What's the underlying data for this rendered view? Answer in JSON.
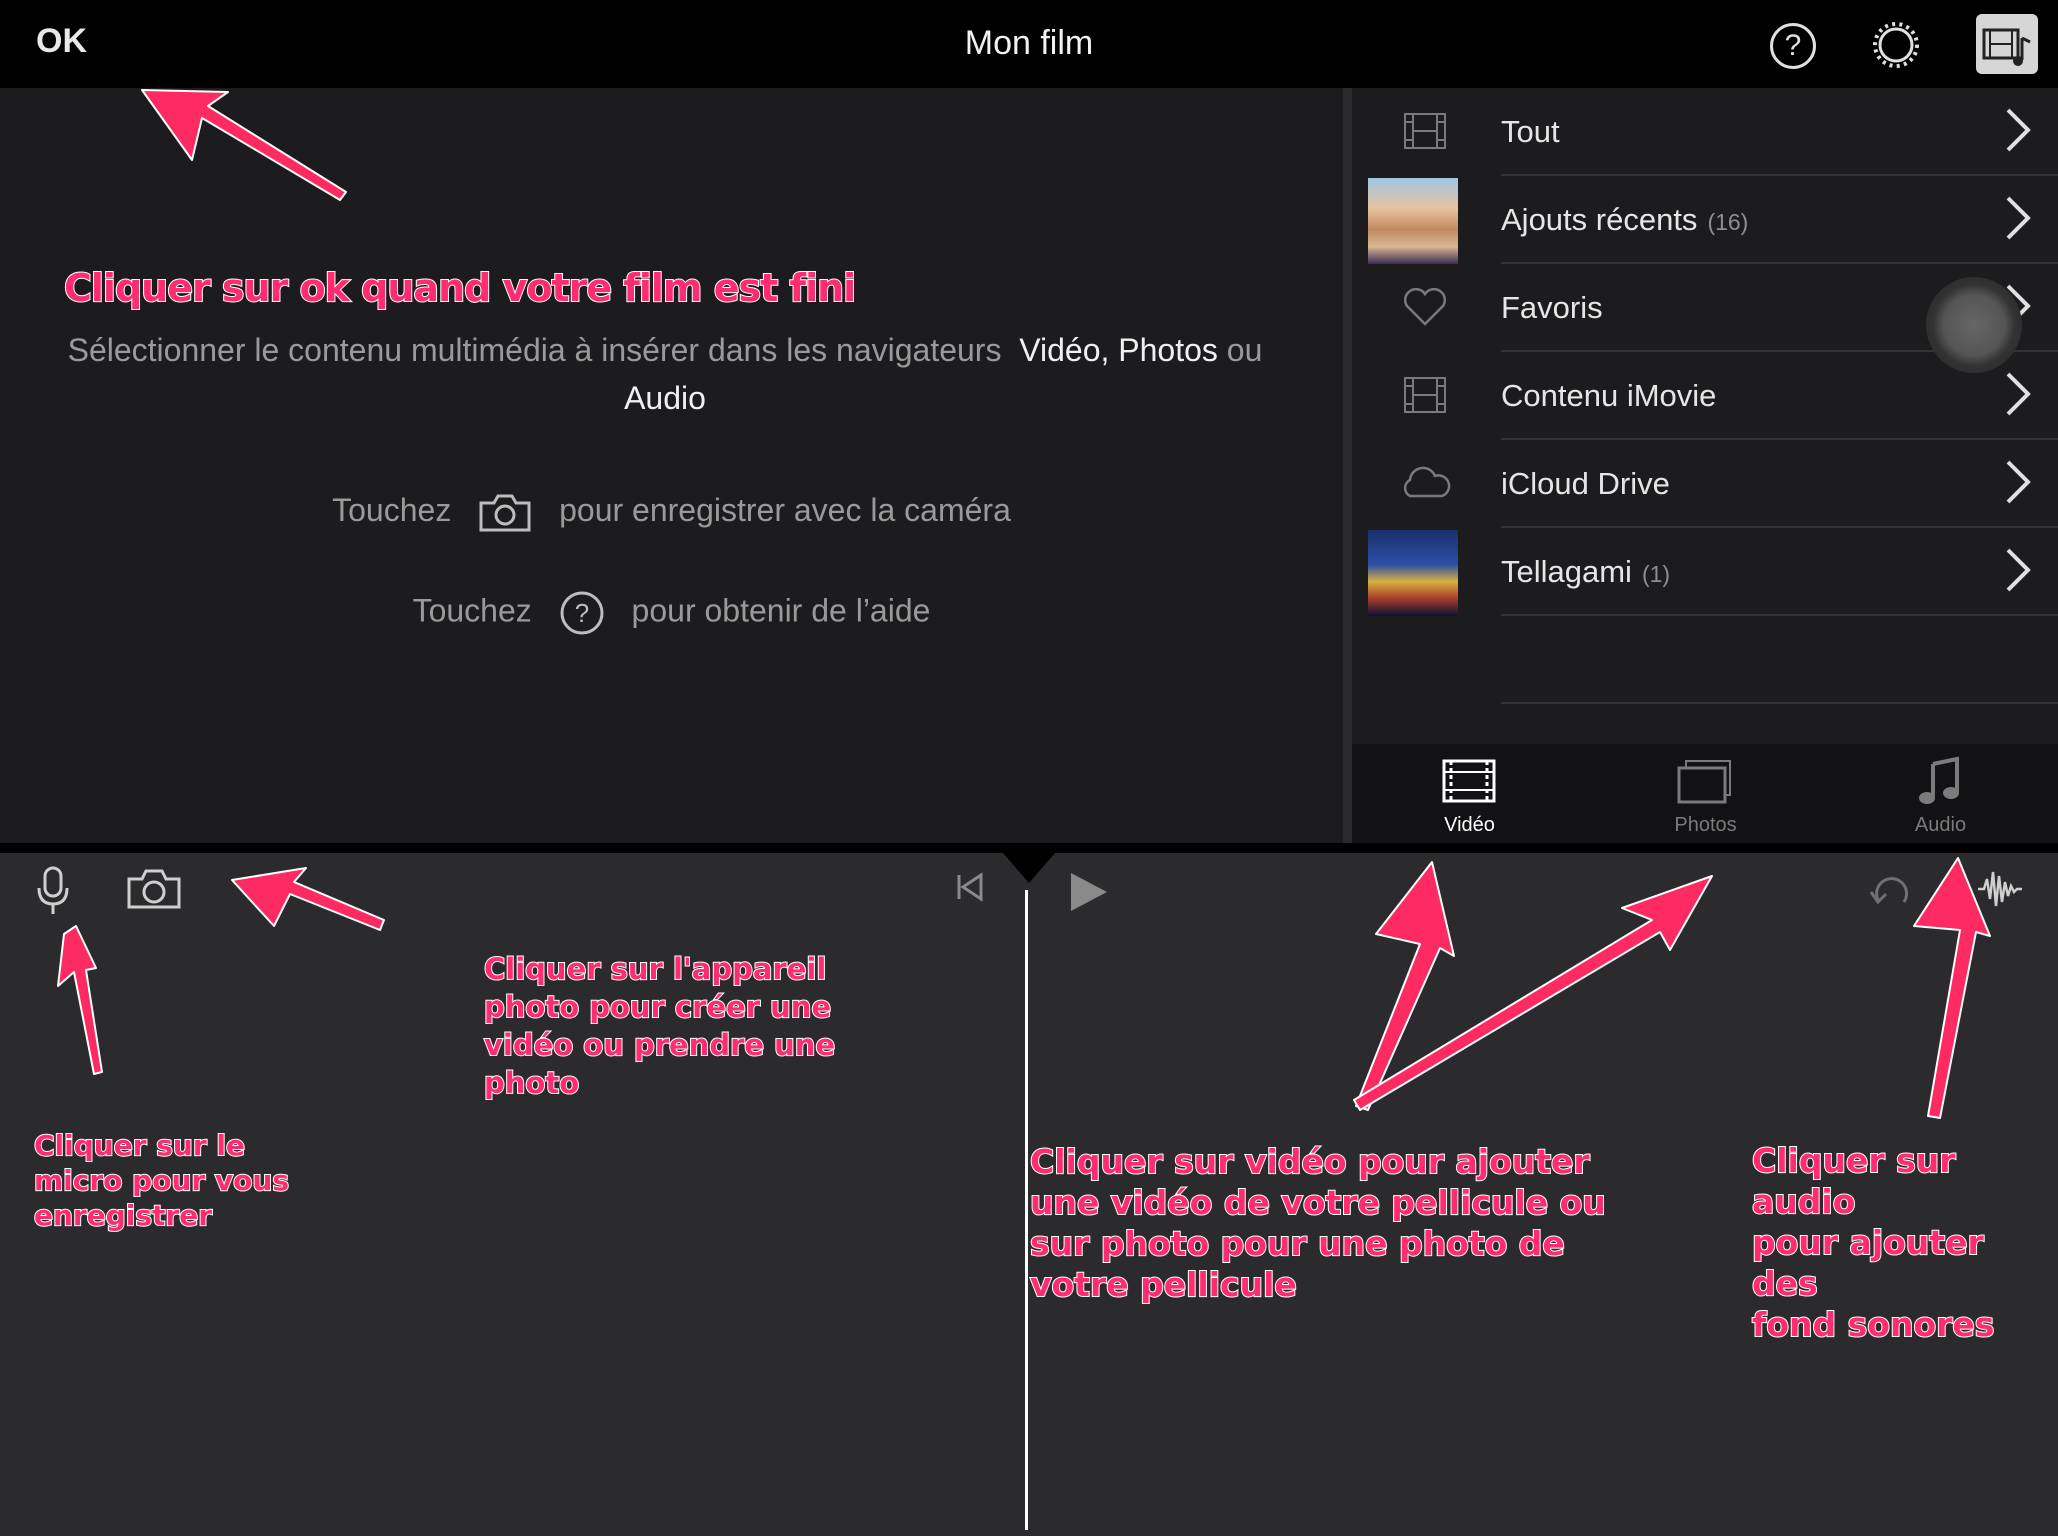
{
  "header": {
    "ok_label": "OK",
    "title": "Mon film"
  },
  "icons": {
    "help": "question-circle-icon",
    "settings": "gear-icon",
    "media": "film-music-icon"
  },
  "annotations": {
    "ok": "Cliquer sur ok quand votre film est fini",
    "mic": [
      "Cliquer sur le",
      "micro pour vous",
      "enregistrer"
    ],
    "camera": [
      "Cliquer sur l'appareil",
      "photo pour créer une",
      "vidéo ou prendre une",
      "photo"
    ],
    "video": [
      "Cliquer  sur vidéo pour ajouter",
      "une vidéo de votre pellicule ou",
      "sur photo pour une photo de",
      "votre pellicule"
    ],
    "audio": [
      "Cliquer sur audio",
      "pour ajouter des",
      "fond sonores"
    ]
  },
  "viewer": {
    "instr_text": "Sélectionner le contenu multimédia à insérer dans les navigateurs",
    "instr_video": "Vidéo,",
    "instr_photos": "Photos",
    "instr_ou": "ou",
    "instr_audio": "Audio",
    "touch1_a": "Touchez",
    "touch1_b": "pour enregistrer avec la caméra",
    "touch2_a": "Touchez",
    "touch2_b": "pour obtenir de l’aide"
  },
  "browser": {
    "rows": [
      {
        "label": "Tout",
        "count": "",
        "icon": "film-icon"
      },
      {
        "label": "Ajouts récents",
        "count": "(16)",
        "icon": "thumbnail"
      },
      {
        "label": "Favoris",
        "count": "",
        "icon": "heart-icon"
      },
      {
        "label": "Contenu iMovie",
        "count": "",
        "icon": "film-icon"
      },
      {
        "label": "iCloud Drive",
        "count": "",
        "icon": "cloud-icon"
      },
      {
        "label": "Tellagami",
        "count": "(1)",
        "icon": "thumbnail"
      }
    ],
    "tabs": [
      {
        "label": "Vidéo",
        "selected": true
      },
      {
        "label": "Photos",
        "selected": false
      },
      {
        "label": "Audio",
        "selected": false
      }
    ]
  },
  "colors": {
    "annotation": "#ff2d6f",
    "arrow": "#fe2a62",
    "background": "#1c1c1e"
  }
}
